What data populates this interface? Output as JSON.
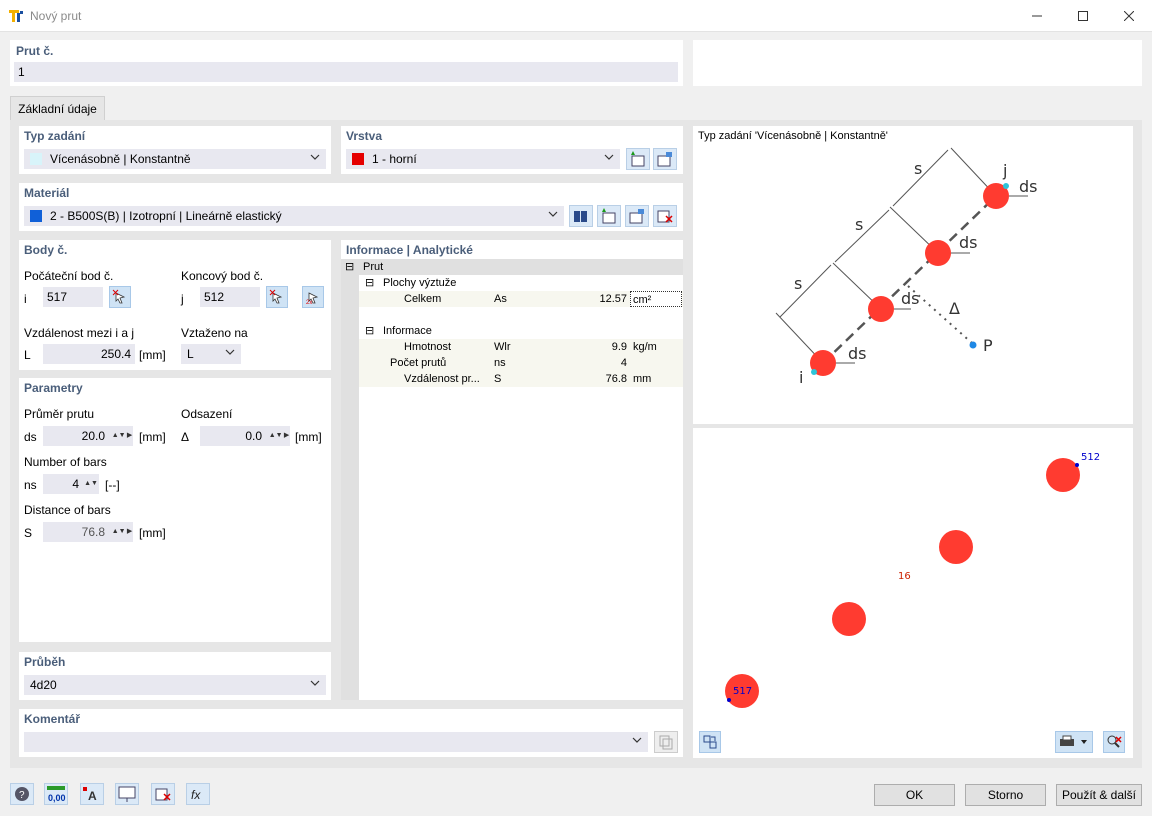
{
  "window": {
    "title": "Nový prut"
  },
  "prut": {
    "label": "Prut č.",
    "value": "1"
  },
  "tabs": [
    {
      "label": "Základní údaje"
    }
  ],
  "typ_zadani": {
    "label": "Typ zadání",
    "value": "Vícenásobně | Konstantně",
    "swatch": "#d8f4fa"
  },
  "vrstva": {
    "label": "Vrstva",
    "value": "1 - horní",
    "swatch": "#e50000"
  },
  "material": {
    "label": "Materiál",
    "value": "2 - B500S(B) | Izotropní | Lineárně elastický",
    "swatch": "#1060d8"
  },
  "body": {
    "label": "Body č.",
    "start_label": "Počáteční bod č.",
    "start_sym": "i",
    "start_value": "517",
    "end_label": "Koncový bod č.",
    "end_sym": "j",
    "end_value": "512",
    "dist_label": "Vzdálenost mezi i a j",
    "dist_sym": "L",
    "dist_value": "250.4",
    "dist_unit": "[mm]",
    "ref_label": "Vztaženo na",
    "ref_value": "L"
  },
  "parametry": {
    "label": "Parametry",
    "diam_label": "Průměr prutu",
    "diam_sym": "ds",
    "diam_value": "20.0",
    "diam_unit": "[mm]",
    "offset_label": "Odsazení",
    "offset_sym": "Δ",
    "offset_value": "0.0",
    "offset_unit": "[mm]",
    "nbars_label": "Number of bars",
    "nbars_sym": "ns",
    "nbars_value": "4",
    "nbars_unit": "[--]",
    "dist_label": "Distance of bars",
    "dist_sym": "S",
    "dist_value": "76.8",
    "dist_unit": "[mm]"
  },
  "prubeh": {
    "label": "Průběh",
    "value": "4d20"
  },
  "komentar": {
    "label": "Komentář",
    "value": ""
  },
  "info": {
    "label": "Informace | Analytické",
    "root": "Prut",
    "group1": "Plochy výztuže",
    "rows1": [
      {
        "name": "Celkem",
        "sym": "As",
        "value": "12.57",
        "unit": "cm²"
      }
    ],
    "group2": "Informace",
    "rows2": [
      {
        "name": "Hmotnost",
        "sym": "Wlr",
        "value": "9.9",
        "unit": "kg/m"
      },
      {
        "name": "Počet prutů",
        "sym": "ns",
        "value": "4",
        "unit": ""
      },
      {
        "name": "Vzdálenost pr...",
        "sym": "S",
        "value": "76.8",
        "unit": "mm"
      }
    ]
  },
  "diagram": {
    "caption": "Typ zadání 'Vícenásobně | Konstantně'",
    "labels": {
      "s1": "s",
      "s2": "s",
      "s3": "s",
      "j": "j",
      "i": "i",
      "ds": "ds",
      "delta": "Δ",
      "p": "P"
    }
  },
  "preview": {
    "label_end": "512",
    "label_mid": "16",
    "label_start": "517"
  },
  "buttons": {
    "ok": "OK",
    "cancel": "Storno",
    "apply_next": "Použít & další"
  },
  "colors": {
    "accent": "#4a5e7a",
    "bar": "#ff3b30",
    "highlight": "#1e88e5"
  }
}
